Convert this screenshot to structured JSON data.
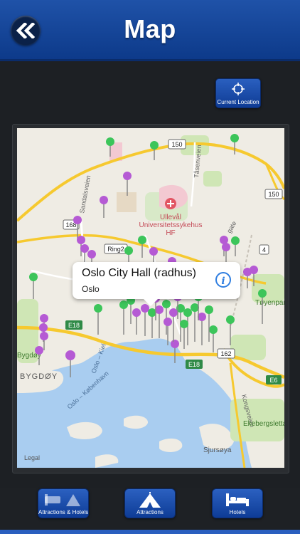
{
  "header": {
    "title": "Map",
    "back_icon": "double-chevron-left-icon"
  },
  "current_location": {
    "label": "Current Location",
    "icon": "crosshair-icon"
  },
  "map": {
    "labels": {
      "road_150_top": "150",
      "road_150_right": "150",
      "road_168": "168",
      "ring2": "Ring2",
      "road_4": "4",
      "e18_left": "E18",
      "e18_bottom": "E18",
      "road_162": "162",
      "e6": "E6",
      "hospital": "Ullevål",
      "hospital_line2": "Universitetssykehus",
      "hospital_line3": "HF",
      "tasenveien": "Tåsenveien",
      "sandalsveien": "Sandalsveien",
      "toyenparken": "Tøyenparken",
      "bygdoy_small": "Bygdøy",
      "bygdoy": "BYGDØY",
      "oslo_kiel": "Oslo – Kiel",
      "oslo_kobenhavn": "Oslo – København",
      "kongsveien": "Kongsveien",
      "ekebergsletta": "Ekebergsletta",
      "sjursoya": "Sjursøya",
      "legal": "Legal",
      "gate": "gate"
    },
    "callout": {
      "title": "Oslo City Hall (radhus)",
      "subtitle": "Oslo",
      "info_icon": "info-icon"
    }
  },
  "tabs": [
    {
      "label": "Attractions & Hotels",
      "icon": "tent-bed-icon"
    },
    {
      "label": "Attractions",
      "icon": "tent-icon"
    },
    {
      "label": "Hotels",
      "icon": "bed-icon"
    }
  ],
  "colors": {
    "accent": "#1f52a8",
    "pin_purple": "#b55ad4",
    "pin_green": "#3cc55a"
  }
}
